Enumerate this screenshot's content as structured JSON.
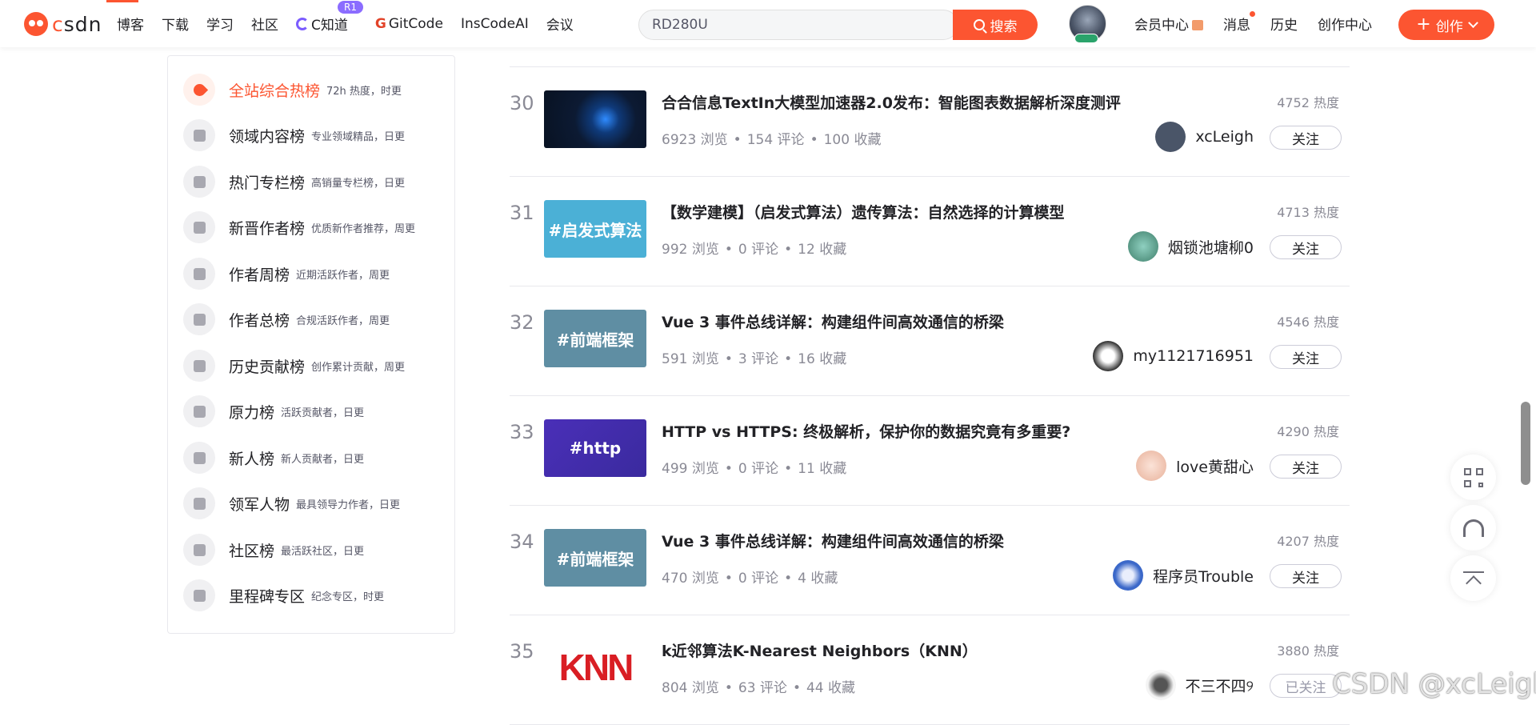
{
  "nav": {
    "logo_text_c": "c",
    "logo_text_rest": "sdn",
    "items": [
      "博客",
      "下载",
      "学习",
      "社区"
    ],
    "cknow": "C知道",
    "cknow_badge": "R1",
    "gitcode": "GitCode",
    "inscode": "InsCodeAI",
    "meeting": "会议",
    "search_value": "RD280U",
    "search_button": "搜索",
    "member": "会员中心",
    "messages": "消息",
    "history": "历史",
    "creation_center": "创作中心",
    "create_button": "创作",
    "accent_color": "#fc5531"
  },
  "sidebar": {
    "items": [
      {
        "title": "全站综合热榜",
        "sub": "72h 热度，时更",
        "active": true
      },
      {
        "title": "领域内容榜",
        "sub": "专业领域精品，日更"
      },
      {
        "title": "热门专栏榜",
        "sub": "高销量专栏榜，日更"
      },
      {
        "title": "新晋作者榜",
        "sub": "优质新作者推荐，周更"
      },
      {
        "title": "作者周榜",
        "sub": "近期活跃作者，周更"
      },
      {
        "title": "作者总榜",
        "sub": "合规活跃作者，周更"
      },
      {
        "title": "历史贡献榜",
        "sub": "创作累计贡献，周更"
      },
      {
        "title": "原力榜",
        "sub": "活跃贡献者，日更"
      },
      {
        "title": "新人榜",
        "sub": "新人贡献者，日更"
      },
      {
        "title": "领军人物",
        "sub": "最具领导力作者，日更"
      },
      {
        "title": "社区榜",
        "sub": "最活跃社区，日更"
      },
      {
        "title": "里程碑专区",
        "sub": "纪念专区，时更"
      }
    ]
  },
  "rows": [
    {
      "rank": "30",
      "title": "合合信息TextIn大模型加速器2.0发布：智能图表数据解析深度测评",
      "views": "6923 浏览",
      "comments": "154 评论",
      "favorites": "100 收藏",
      "heat": "4752 热度",
      "author": "xcLeigh",
      "follow": "关注",
      "thumb_text": "",
      "thumb_bg": "#0c1a33",
      "avatar_bg": "#4a5568"
    },
    {
      "rank": "31",
      "title": "【数学建模】（启发式算法）遗传算法：自然选择的计算模型",
      "views": "992 浏览",
      "comments": "0 评论",
      "favorites": "12 收藏",
      "heat": "4713 热度",
      "author": "烟锁池塘柳0",
      "follow": "关注",
      "thumb_text": "#启发式算法",
      "thumb_bg": "#4bb0d6",
      "avatar_bg": "#3f7f6b"
    },
    {
      "rank": "32",
      "title": "Vue 3 事件总线详解：构建组件间高效通信的桥梁",
      "views": "591 浏览",
      "comments": "3 评论",
      "favorites": "16 收藏",
      "heat": "4546 热度",
      "author": "my1121716951",
      "follow": "关注",
      "thumb_text": "#前端框架",
      "thumb_bg": "#5f8ea3",
      "avatar_bg": "#2d2d2d"
    },
    {
      "rank": "33",
      "title": "HTTP vs HTTPS: 终极解析，保护你的数据究竟有多重要?",
      "views": "499 浏览",
      "comments": "0 评论",
      "favorites": "11 收藏",
      "heat": "4290 热度",
      "author": "love黄甜心",
      "follow": "关注",
      "thumb_text": "#http",
      "thumb_bg": "#4a2fb8",
      "avatar_bg": "#f0c8b8"
    },
    {
      "rank": "34",
      "title": "Vue 3 事件总线详解：构建组件间高效通信的桥梁",
      "views": "470 浏览",
      "comments": "0 评论",
      "favorites": "4 收藏",
      "heat": "4207 热度",
      "author": "程序员Trouble",
      "follow": "关注",
      "thumb_text": "#前端框架",
      "thumb_bg": "#5f8ea3",
      "avatar_bg": "#3b68c9"
    },
    {
      "rank": "35",
      "title": "k近邻算法K-Nearest Neighbors（KNN）",
      "views": "804 浏览",
      "comments": "63 评论",
      "favorites": "44 收藏",
      "heat": "3880 热度",
      "author": "不三不四୨",
      "follow": "已关注",
      "thumb_text": "KNN",
      "thumb_bg": "#ffffff",
      "avatar_bg": "#555555"
    }
  ],
  "watermark": "CSDN @xcLeigh"
}
